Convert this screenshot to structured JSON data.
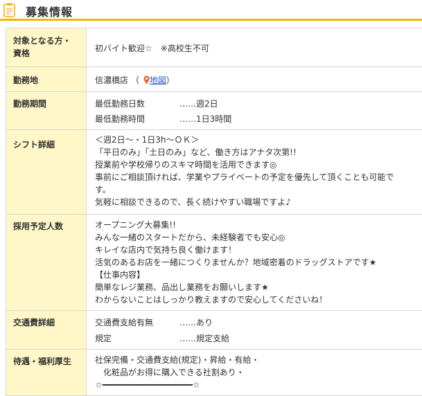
{
  "header": {
    "title": "募集情報",
    "icon": "document-icon",
    "accent": "#f5b400"
  },
  "rows": {
    "target": {
      "label_1": "対象となる方・",
      "label_2": "資格",
      "value": "初バイト歓迎☆　※高校生不可"
    },
    "location": {
      "label": "勤務地",
      "store": "信濃橋店",
      "paren_open": "（",
      "map_label": "地図",
      "paren_close": "）",
      "pin_color": "#e8632b"
    },
    "period": {
      "label": "勤務期間",
      "items": [
        {
          "key": "最低勤務日数",
          "value": "……週2日"
        },
        {
          "key": "最低勤務時間",
          "value": "……1日3時間"
        }
      ]
    },
    "shift": {
      "label": "シフト詳細",
      "lines": [
        "＜週2日～・1日3h～ＯＫ＞",
        "「平日のみ」「土日のみ」など、働き方はアナタ次第!!",
        "授業前や学校帰りのスキマ時間を活用できます◎",
        "事前にご相談頂ければ、学業やプライベートの予定を優先して頂くことも可能で",
        "す。",
        "気軽に相談できるので、長く続けやすい職場ですよ♪"
      ]
    },
    "hiring": {
      "label": "採用予定人数",
      "lines": [
        "オープニング大募集!!",
        "みんな一緒のスタートだから、未経験者でも安心◎",
        "キレイな店内で気持ち良く働けます！",
        "活気のあるお店を一緒につくりませんか？地域密着のドラッグストアです★",
        "【仕事内容】",
        "簡単なレジ業務、品出し業務をお願いします★",
        "わからないことはしっかり教えますので安心してくださいね！"
      ]
    },
    "transport": {
      "label": "交通費詳細",
      "items": [
        {
          "key": "交通費支給有無",
          "value": "……あり"
        },
        {
          "key": "規定",
          "value": "……規定支給"
        }
      ]
    },
    "benefits": {
      "label": "待遇・福利厚生",
      "lines": [
        "社保完備・交通費支給(規定)・昇給・有給・",
        "化粧品がお得に購入できる社割あり・",
        "☆━━━━━━━━━━━━━━━━━━☆"
      ]
    }
  }
}
